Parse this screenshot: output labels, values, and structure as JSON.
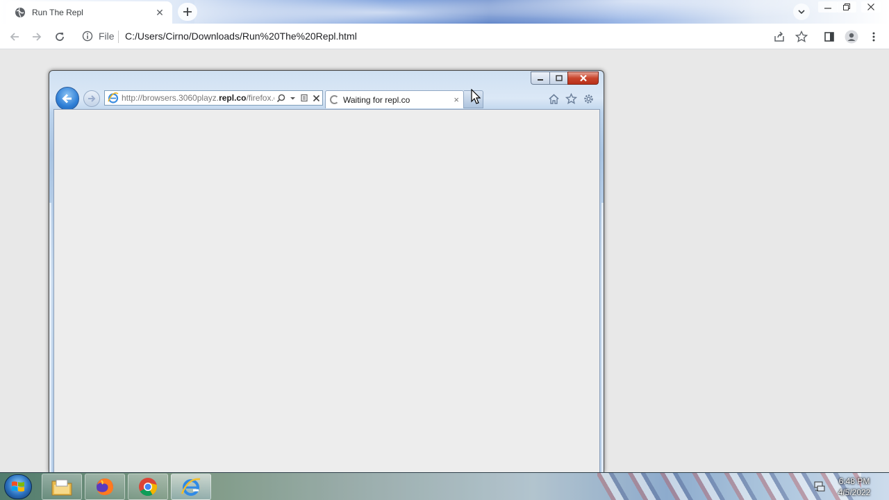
{
  "chrome": {
    "tab": {
      "title": "Run The Repl",
      "close_symbol": "✕"
    },
    "new_tab_symbol": "+",
    "omnibox": {
      "file_label": "File",
      "url": "C:/Users/Cirno/Downloads/Run%20The%20Repl.html"
    }
  },
  "ie": {
    "address": {
      "url_prefix": "http://browsers.3060playz.",
      "url_domain": "repl.co",
      "url_suffix": "/firefox.e"
    },
    "tab": {
      "title": "Waiting for repl.co",
      "close_symbol": "×"
    },
    "icons": [
      "home-icon",
      "star-icon",
      "gear-icon"
    ]
  },
  "taskbar": {
    "apps": [
      "file-explorer-icon",
      "firefox-icon",
      "chrome-icon",
      "internet-explorer-icon"
    ],
    "active_app": "internet-explorer-icon",
    "clock": {
      "time": "6:48 PM",
      "date": "4/5/2022"
    }
  },
  "colors": {
    "chrome_accent": "#1a73e8",
    "ie_close_red": "#c9452c",
    "ie_back_blue": "#2f7fd6"
  }
}
